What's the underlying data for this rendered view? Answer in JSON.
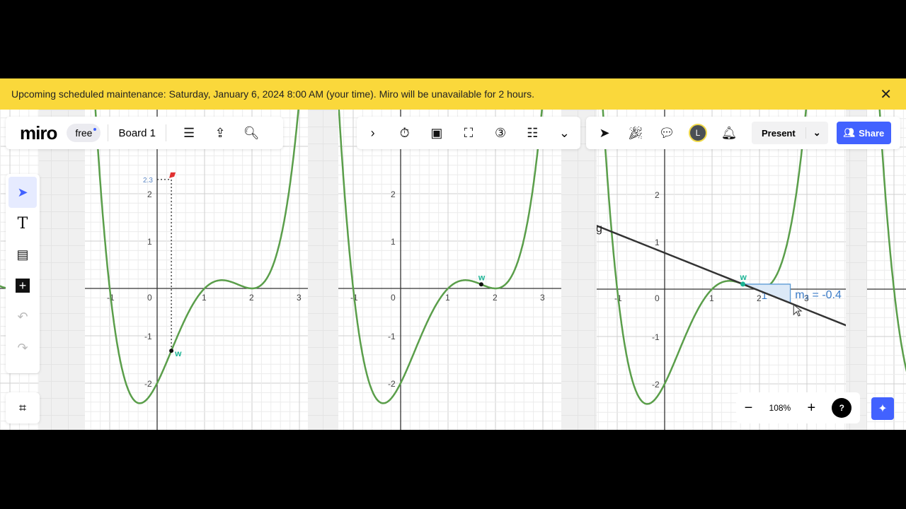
{
  "banner": {
    "text": "Upcoming scheduled maintenance: Saturday, January 6, 2024 8:00 AM (your time). Miro will be unavailable for 2 hours.",
    "close_icon": "close-icon"
  },
  "topbar": {
    "logo": "miro",
    "plan_badge": "free",
    "board_name": "Board 1"
  },
  "right_toolbar": {
    "present_label": "Present",
    "share_label": "Share",
    "avatar_initial": "L"
  },
  "zoom": {
    "level": "108%",
    "minus": "−",
    "plus": "+",
    "help": "?"
  },
  "colors": {
    "curve": "#5a9e4a",
    "tangent": "#333333",
    "point_label": "#1ab394",
    "accent": "#4262ff",
    "banner": "#fad83b",
    "slope_label": "#3a7bc8",
    "marker": "#e03030"
  },
  "graphs": {
    "x_ticks": [
      "-1",
      "0",
      "1",
      "2",
      "3"
    ],
    "y_ticks": [
      "-2",
      "-1",
      "1",
      "2"
    ],
    "graph1": {
      "point_label": "w",
      "guide_value": "2.3"
    },
    "graph2": {
      "point_label": "w"
    },
    "graph3": {
      "point_label": "w",
      "line_label": "g",
      "slope_triangle_run": "1",
      "slope_label": "m₃ = -0.4",
      "slope": -0.4
    }
  }
}
